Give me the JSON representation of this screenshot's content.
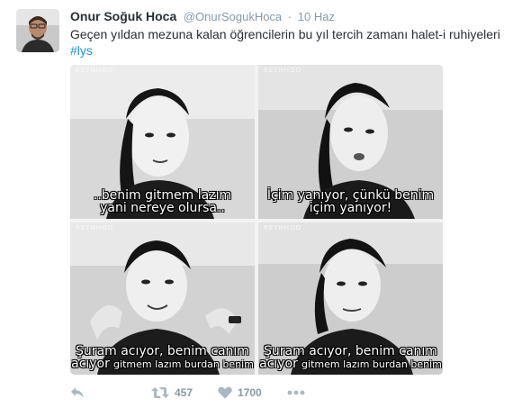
{
  "author": {
    "name": "Onur Soğuk Hoca",
    "handle": "@OnurSogukHoca",
    "separator": "·",
    "date": "10 Haz"
  },
  "tweet": {
    "text": "Geçen yıldan mezuna kalan öğrencilerin bu yıl tercih zamanı halet-i ruhiyeleri",
    "hashtag": "#lys"
  },
  "media": {
    "watermark": "REYNHOO",
    "panels": [
      {
        "caption_line1": "..benim gitmem lazım",
        "caption_line2": "yani nereye olursa.."
      },
      {
        "caption_line1": "İçim yanıyor, çünkü benim",
        "caption_line2": "içim yanıyor!"
      },
      {
        "caption_line1": "Şuram acıyor, benim canım",
        "caption_line2_big": "acıyor",
        "caption_line2_small": "gitmem lazım burdan benim"
      },
      {
        "caption_line1": "Şuram acıyor, benim canım",
        "caption_line2_big": "acıyor",
        "caption_line2_small": "gitmem lazım burdan benim"
      }
    ]
  },
  "actions": {
    "reply_icon": "reply-icon",
    "retweet_icon": "retweet-icon",
    "retweet_count": "457",
    "like_icon": "heart-icon",
    "like_count": "1700",
    "more_icon": "more-icon"
  },
  "colors": {
    "link": "#1b95e0",
    "muted": "#8899a6",
    "icon": "#aab8c2",
    "text": "#292f33"
  }
}
